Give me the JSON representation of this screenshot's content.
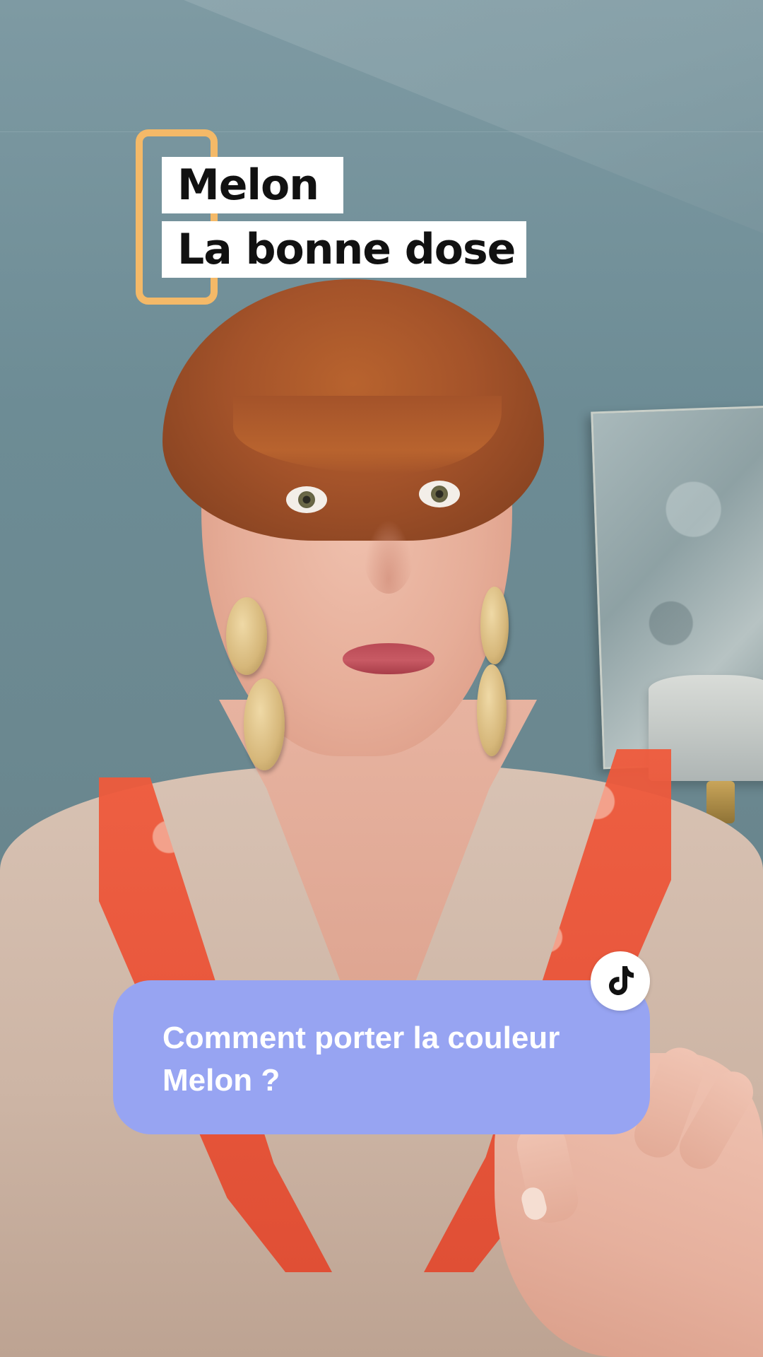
{
  "overlay": {
    "title_line_1": "Melon",
    "title_line_2": "La bonne dose",
    "bracket_color": "#f4b968"
  },
  "question": {
    "text_line_1": "Comment porter la couleur",
    "text_line_2": "Melon ?",
    "bubble_color": "#97a4f2",
    "badge_icon": "tiktok-icon"
  },
  "scene": {
    "background_icon": "woman-speaking-photo"
  }
}
